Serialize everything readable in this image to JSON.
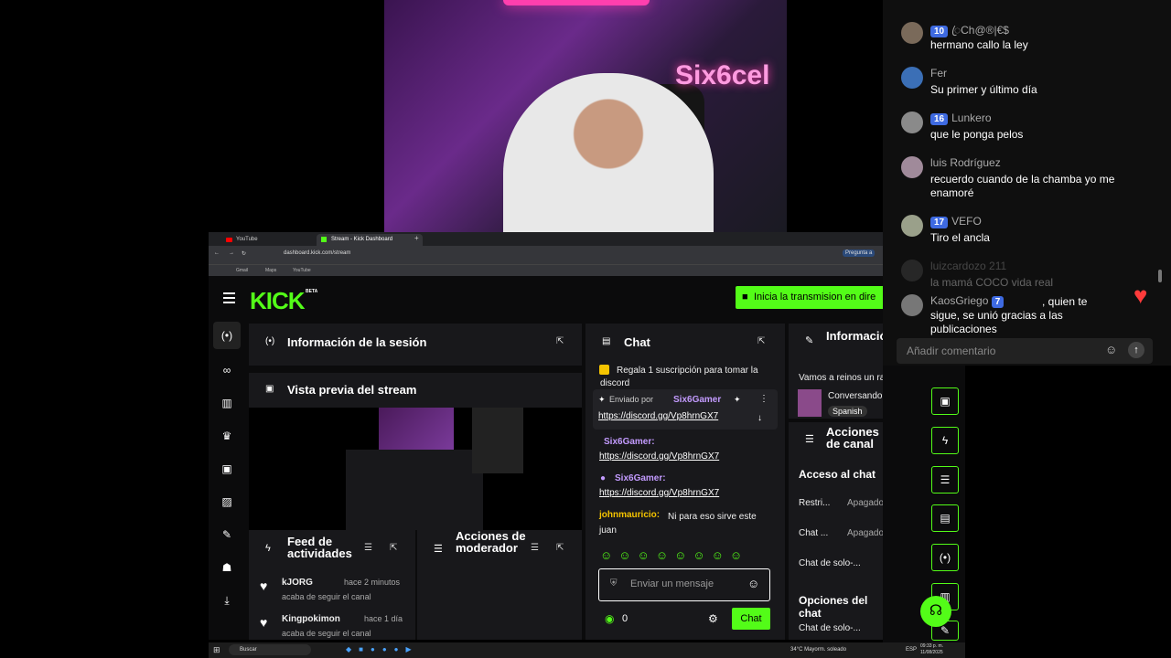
{
  "webcam": {
    "neon_sign": "Six6cel"
  },
  "browser": {
    "tabs": [
      {
        "label": "YouTube"
      },
      {
        "label": "Stream - Kick Dashboard"
      }
    ],
    "url": "dashboard.kick.com/stream",
    "bookmarks": [
      "Gmail",
      "Maps",
      "YouTube"
    ],
    "ask_label": "Pregunta a"
  },
  "kick": {
    "logo": "KICK",
    "beta": "BETA",
    "go_live_label": "Inicia la transmision en dire",
    "session_info": {
      "title": "Información de la sesión"
    },
    "preview": {
      "title": "Vista previa del stream"
    },
    "activity_feed": {
      "title": "Feed de actividades",
      "items": [
        {
          "user": "kJORG",
          "time": "hace 2 minutos",
          "text": "acaba de seguir el canal"
        },
        {
          "user": "Kingpokimon",
          "time": "hace 1 día",
          "text": "acaba de seguir el canal"
        }
      ]
    },
    "mod_actions": {
      "title": "Acciones de moderador"
    },
    "chat": {
      "title": "Chat",
      "gift_banner": "Regala 1 suscripción para tomar la",
      "gift_sub": "discord",
      "pinned_by": "Enviado por",
      "pinned_user": "Six6Gamer",
      "pinned_link": "https://discord.gg/Vp8hrnGX7",
      "messages": [
        {
          "user": "Six6Gamer:",
          "text": "https://discord.gg/Vp8hrnGX7"
        },
        {
          "user": "Six6Gamer:",
          "text": "https://discord.gg/Vp8hrnGX7"
        },
        {
          "user": "johnmauricio:",
          "text": "Ni para eso sirve este juan"
        }
      ],
      "input_placeholder": "Enviar un mensaje",
      "points": "0",
      "send_label": "Chat"
    },
    "stream_info": {
      "title": "Información del stream",
      "stream_title": "Vamos a reinos un rato",
      "category": "Conversando",
      "language": "Spanish"
    },
    "channel_actions": {
      "title": "Acciones de canal",
      "chat_access": "Acceso al chat",
      "rows": [
        {
          "label": "Restri...",
          "value": "Apagado"
        },
        {
          "label": "Chat ...",
          "value": "Apagado"
        }
      ],
      "solo_1": "Chat de solo-...",
      "chat_options": "Opciones del chat",
      "solo_2": "Chat de solo-..."
    }
  },
  "yt_chat": {
    "messages": [
      {
        "name": "ꦿCh@®|€$",
        "badge": "10",
        "msg": "hermano callo la ley",
        "color": "#7a6a5a"
      },
      {
        "name": "Fer",
        "badge": "",
        "msg": "Su primer y último día",
        "color": "#3b6fb6"
      },
      {
        "name": "Lunkero",
        "badge": "16",
        "msg": "que le ponga pelos",
        "color": "#8a8a8a"
      },
      {
        "name": "luis Rodríguez",
        "badge": "",
        "msg": "recuerdo cuando de la chamba yo me enamoré",
        "color": "#a08a9a"
      },
      {
        "name": "VEFO",
        "badge": "17",
        "msg": "Tiro el ancla",
        "color": "#9aa08a"
      },
      {
        "name": "luizcardozo 211",
        "badge": "",
        "msg": "la mamá COCO vida real",
        "color": "#555"
      },
      {
        "name": "KaosGriego",
        "badge": "7",
        "msg": ", quien te sigue, se unió gracias a las publicaciones",
        "color": "#777"
      }
    ],
    "input_placeholder": "Añadir comentario"
  },
  "taskbar": {
    "search": "Buscar",
    "weather": "34°C Mayorm. soleado",
    "lang": "ESP",
    "time": "09:33 p. m.",
    "date": "11/08/2025"
  },
  "colors": {
    "kick_green": "#53fc18",
    "panel_bg": "#18181b",
    "yt_badge": "#3e6ae1"
  }
}
